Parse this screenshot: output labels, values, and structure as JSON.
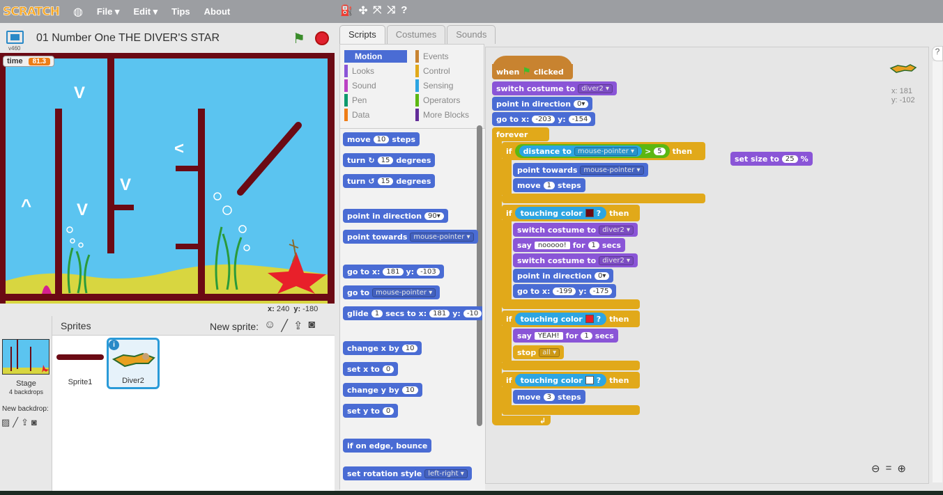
{
  "menubar": {
    "logo": "SCRATCH",
    "file": "File ▾",
    "edit": "Edit ▾",
    "tips": "Tips",
    "about": "About"
  },
  "project": {
    "title": "01 Number One THE DIVER'S STAR",
    "version": "v460"
  },
  "stage": {
    "var_label": "time",
    "var_value": "81.3",
    "x_label": "x:",
    "x_val": "240",
    "y_label": "y:",
    "y_val": "-180",
    "arrows": [
      "V",
      "V",
      "<",
      "^",
      "V"
    ]
  },
  "sprites": {
    "header": "Sprites",
    "new_sprite": "New sprite:",
    "stage_label": "Stage",
    "backdrops": "4 backdrops",
    "new_backdrop": "New backdrop:",
    "list": [
      {
        "name": "Sprite1"
      },
      {
        "name": "Diver2"
      }
    ]
  },
  "tabs": [
    "Scripts",
    "Costumes",
    "Sounds"
  ],
  "categories": [
    {
      "label": "Motion",
      "color": "#4a6cd4"
    },
    {
      "label": "Looks",
      "color": "#8a55d7"
    },
    {
      "label": "Sound",
      "color": "#bb42c3"
    },
    {
      "label": "Pen",
      "color": "#0e9a6c"
    },
    {
      "label": "Data",
      "color": "#ee7d16"
    },
    {
      "label": "Events",
      "color": "#c88330"
    },
    {
      "label": "Control",
      "color": "#e1a91a"
    },
    {
      "label": "Sensing",
      "color": "#2ca5e2"
    },
    {
      "label": "Operators",
      "color": "#5cb712"
    },
    {
      "label": "More Blocks",
      "color": "#632d99"
    }
  ],
  "palette": {
    "move": "move",
    "move_val": "10",
    "steps": "steps",
    "turn": "turn",
    "turn_val": "15",
    "degrees": "degrees",
    "point_dir": "point in direction",
    "dir_val": "90▾",
    "point_towards": "point towards",
    "mouse_pointer": "mouse-pointer ▾",
    "goto_x": "go to x:",
    "gx": "181",
    "y": "y:",
    "gy": "-103",
    "goto": "go to",
    "glide": "glide",
    "glide_val": "1",
    "secs_to_x": "secs to x:",
    "glx": "181",
    "gly": "-10",
    "change_x": "change x by",
    "cx": "10",
    "set_x": "set x to",
    "sx": "0",
    "change_y": "change y by",
    "cy": "10",
    "set_y": "set y to",
    "sy": "0",
    "bounce": "if on edge, bounce",
    "rot": "set rotation style",
    "rot_val": "left-right ▾"
  },
  "script": {
    "when": "when",
    "clicked": "clicked",
    "switch": "switch costume to",
    "diver2": "diver2 ▾",
    "point_dir": "point in direction",
    "zero": "0▾",
    "goto": "go to x:",
    "x1": "-203",
    "y": "y:",
    "y1": "-154",
    "forever": "forever",
    "if": "if",
    "then": "then",
    "distance": "distance to",
    "mp": "mouse-pointer ▾",
    "gt": ">",
    "five": "5",
    "towards": "point towards",
    "move": "move",
    "one": "1",
    "steps": "steps",
    "touching": "touching color",
    "q": "?",
    "say": "say",
    "nooo": "nooooo!",
    "for": "for",
    "secs": "secs",
    "x2": "-199",
    "y2": "-175",
    "yeah": "YEAH!",
    "stop": "stop",
    "all": "all ▾",
    "three": "3",
    "setsize": "set size to",
    "size": "25",
    "pct": "%"
  },
  "sprite_info": {
    "x": "x: 181",
    "y": "y: -102"
  },
  "colors": {
    "wall": "#6b0a14",
    "star": "#e8202a",
    "sand": "#d8d640",
    "water": "#5bc4f0",
    "white": "#ffffff"
  }
}
